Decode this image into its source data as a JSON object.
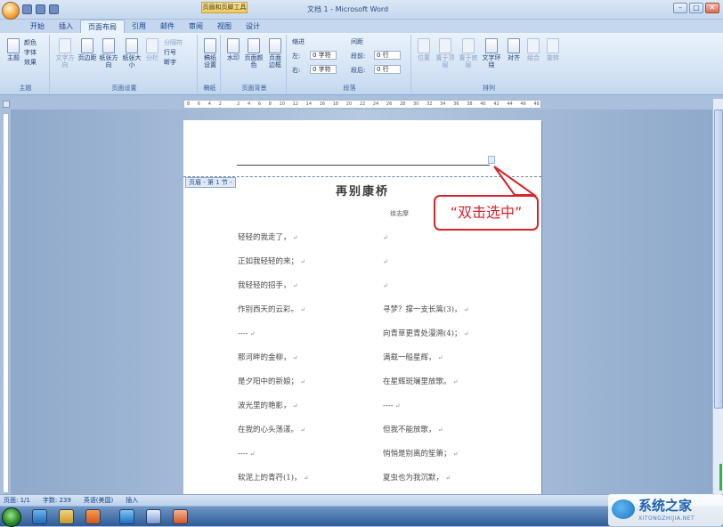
{
  "window": {
    "title": "文档 1 - Microsoft Word",
    "context_tab": "页眉和页脚工具",
    "controls": [
      "–",
      "□",
      "✕"
    ]
  },
  "ribbon_tabs": [
    "开始",
    "插入",
    "页面布局",
    "引用",
    "邮件",
    "审阅",
    "视图",
    "设计"
  ],
  "active_tab": "页面布局",
  "ribbon": {
    "theme_group": {
      "label": "主题",
      "main_button": "主题",
      "colors": "颜色",
      "fonts": "字体",
      "effects": "效果"
    },
    "page_setup": {
      "label": "页面设置",
      "buttons": [
        "文字方向",
        "页边距",
        "纸张方向",
        "纸张大小",
        "分栏"
      ],
      "side": [
        "分隔符",
        "行号",
        "断字"
      ]
    },
    "manuscript": {
      "label": "稿纸",
      "button": "稿纸设置"
    },
    "background": {
      "label": "页面背景",
      "buttons": [
        "水印",
        "页面颜色",
        "页面边框"
      ]
    },
    "paragraph": {
      "label": "段落",
      "indent_title": "缩进",
      "spacing_title": "间距",
      "left_label": "左:",
      "left_value": "0 字符",
      "right_label": "右:",
      "right_value": "0 字符",
      "before_label": "段前:",
      "before_value": "0 行",
      "after_label": "段后:",
      "after_value": "0 行"
    },
    "arrange": {
      "label": "排列",
      "buttons": [
        "位置",
        "置于顶层",
        "置于底层",
        "文字环绕",
        "对齐",
        "组合",
        "旋转"
      ]
    }
  },
  "ruler": {
    "numbers": [
      "8",
      "6",
      "4",
      "2",
      "",
      "2",
      "4",
      "6",
      "8",
      "10",
      "12",
      "14",
      "16",
      "18",
      "20",
      "22",
      "24",
      "26",
      "28",
      "30",
      "32",
      "34",
      "36",
      "38",
      "40",
      "42",
      "44",
      "46",
      "48"
    ]
  },
  "document": {
    "header_tag": "页眉 - 第 1 节 -",
    "title": "再别康桥",
    "author": "徐志摩",
    "left_column": [
      "轻轻的我走了，",
      "正如我轻轻的来；",
      "我轻轻的招手，",
      "作别西天的云彩。",
      "----",
      "那河畔的金柳，",
      "是夕阳中的新娘；",
      "波光里的艳影，",
      "在我的心头荡漾。",
      "----",
      "软泥上的青荇(1)，"
    ],
    "right_column": [
      "",
      "",
      "",
      "寻梦？撑一支长篙(3)，",
      "向青草更青处漫溯(4)；",
      "满载一船星辉，",
      "在星辉斑斓里放歌。",
      "----",
      "但我不能放歌，",
      "悄悄是别离的笙箫；",
      "夏虫也为我沉默，"
    ]
  },
  "callout": {
    "text": "“双击选中”"
  },
  "statusbar": {
    "page": "页面: 1/1",
    "words": "字数: 239",
    "language": "英语(美国)",
    "mode": "插入"
  },
  "watermark": {
    "title": "系统之家",
    "subtitle": "XITONGZHIJIA.NET"
  }
}
